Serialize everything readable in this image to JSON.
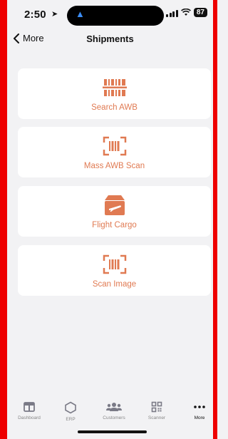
{
  "status": {
    "time": "2:50",
    "battery": "87"
  },
  "nav": {
    "back_label": "More",
    "title": "Shipments"
  },
  "accent_color": "#e07a52",
  "cards": [
    {
      "label": "Search AWB",
      "icon": "barcode-icon"
    },
    {
      "label": "Mass AWB Scan",
      "icon": "barcode-scan-icon"
    },
    {
      "label": "Flight Cargo",
      "icon": "flight-box-icon"
    },
    {
      "label": "Scan Image",
      "icon": "barcode-scan-icon"
    }
  ],
  "tabs": [
    {
      "label": "Dashboard",
      "icon": "dashboard-icon"
    },
    {
      "label": "ERP",
      "icon": "hexagon-icon"
    },
    {
      "label": "Customers",
      "icon": "customers-icon"
    },
    {
      "label": "Scanner",
      "icon": "qr-icon"
    },
    {
      "label": "More",
      "icon": "more-icon",
      "active": true
    }
  ]
}
